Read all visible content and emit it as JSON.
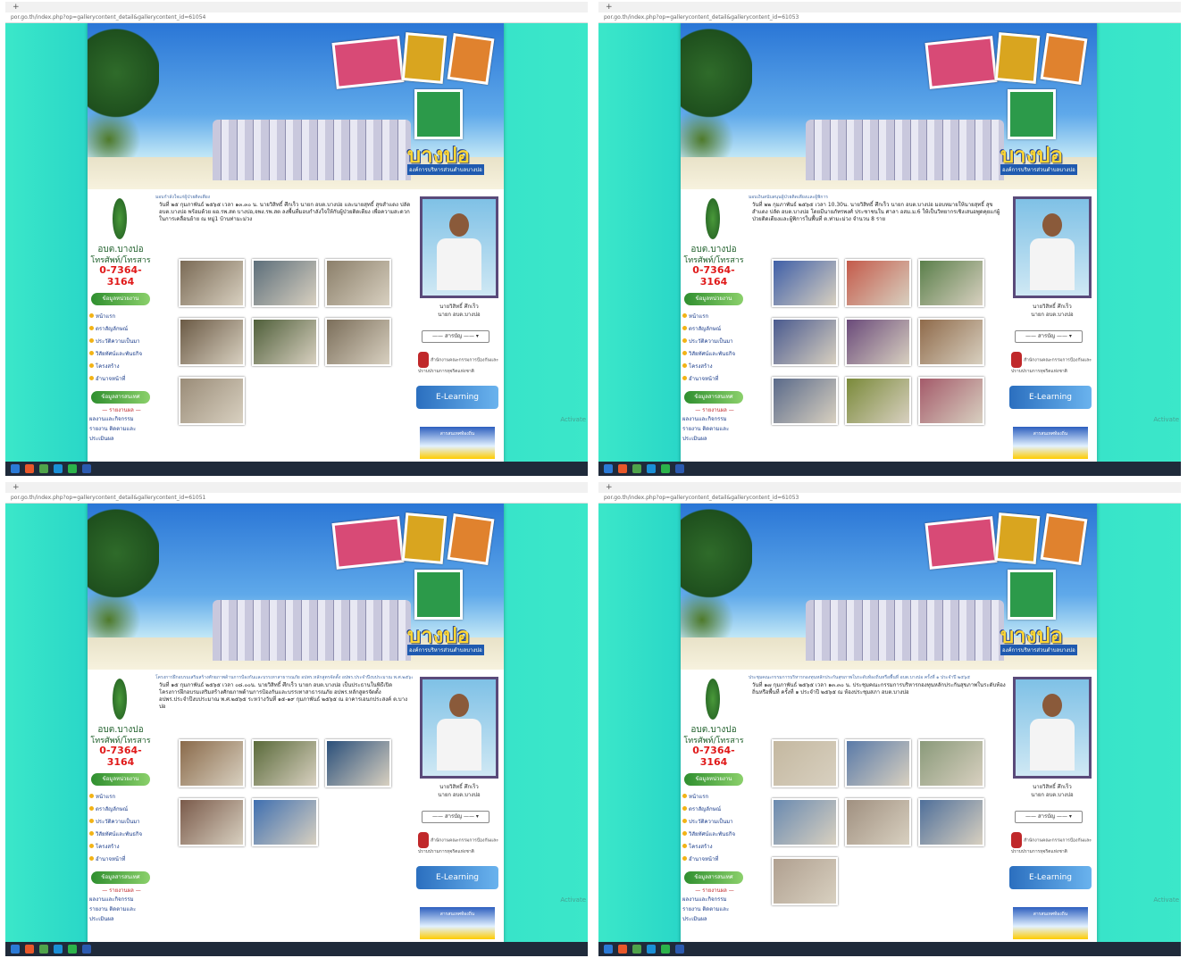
{
  "quadrants": [
    {
      "tab_label": "+",
      "url": "por.go.th/index.php?op=gallerycontent_detail&gallerycontent_id=61054",
      "breadcrumb": "มอบกำลังใจแก่ผู้ป่วยติดเตียง",
      "body_text": "วันที่ ๒๕ กุมภาพันธ์ ๒๕๖๕ เวลา ๑๓.๓๐ น. นายวิสิทธิ์ ศึกเร็ว นายก อบต.บางปอ และนายสุทธิ์ สุขสำแดง ปลัด อบต.บางปอ พร้อมด้วย ผอ.รพ.สต บางปอ,จพง.รพ.สต ลงพื้นที่มอบกำลังใจให้กับผู้ป่วยติดเตียง เพื่อความสะดวกในการเคลื่อนย้าย ณ หมู่1 บ้านท่ามะม่วง"
    },
    {
      "tab_label": "+",
      "url": "por.go.th/index.php?op=gallerycontent_detail&gallerycontent_id=61053",
      "breadcrumb": "มอบเงินสนับสนุนผู้ป่วยติดเตียงและผู้พิการ",
      "body_text": "วันที่ ๒๒ กุมภาพันธ์ ๒๕๖๕ เวลา 10.30น. นายวิสิทธิ์ ศึกเร็ว นายก อบต.บางปอ มอบหมายให้นายสุทธิ์ สุขสำแดง ปลัด อบต.บางปอ โดยมีนายภัทรพงศ์ ประชาชนใน ศาลา อสม.ม.6 ให้เป็นวิทยากรเชิงเสนอพูดคุยแก่ผู้ป่วยติดเตียงและผู้พิการในพื้นที่ ต.ท่ามะม่วง จำนวน 8 ราย"
    },
    {
      "tab_label": "+",
      "url": "por.go.th/index.php?op=gallerycontent_detail&gallerycontent_id=61051",
      "breadcrumb": "โครงการฝึกอบรมเสริมสร้างศักยภาพด้านการป้องกันและบรรเทาสาธารณภัย อปพร.หลักสูตรจัดตั้ง อปพร.ประจำปีงบประมาณ พ.ศ.๒๕๖๕",
      "body_text": "วันที่ ๑๕ กุมภาพันธ์ ๒๕๖๕ เวลา ๐๘.๐๐น. นายวิสิทธิ์ ศึกเร็ว นายก อบต.บางปอ เป็นประธานในพิธีเปิดโครงการฝึกอบรมเสริมสร้างศักยภาพด้านการป้องกันและบรรเทาสาธารณภัย อปพร.หลักสูตรจัดตั้ง อปพร.ประจำปีงบประมาณ พ.ศ.๒๕๖๕ ระหว่างวันที่ ๑๕-๑๙ กุมภาพันธ์ ๒๕๖๕ ณ อาคารเอนกประสงค์ ต.บางปอ"
    },
    {
      "tab_label": "+",
      "url": "por.go.th/index.php?op=gallerycontent_detail&gallerycontent_id=61053",
      "breadcrumb": "ประชุมคณะกรรมการบริหารกองทุนหลักประกันสุขภาพในระดับท้องถิ่นหรือพื้นที่ อบต.บางปอ ครั้งที่ ๑ ประจำปี ๒๕๖๕",
      "body_text": "วันที่ ๑๗ กุมภาพันธ์ ๒๕๖๕ เวลา ๑๓.๓๐ น. ประชุมคณะกรรมการบริหารกองทุนหลักประกันสุขภาพในระดับท้องถิ่นหรือพื้นที่ ครั้งที่ ๑ ประจำปี ๒๕๖๕ ณ ห้องประชุมสภา อบต.บางปอ"
    }
  ],
  "site": {
    "logo_text": "บางปอ",
    "logo_sub": "องค์การบริหารส่วนตำบลบางปอ",
    "org_name": "อบต.บางปอ",
    "phone_label": "โทรศัพท์/โทรสาร",
    "phone_number": "0-7364-3164",
    "section_menu": "ข้อมูลหน่วยงาน",
    "section_reports": "ข้อมูลสารสนเทศ",
    "menu": [
      "หน้าแรก",
      "ตราสัญลักษณ์",
      "ประวัติความเป็นมา",
      "วิสัยทัศน์และพันธกิจ",
      "โครงสร้าง",
      "อำนาจหน้าที่"
    ],
    "reports_head": "— รายงานผล —",
    "reports": [
      "ผลงานและกิจกรรม",
      "รายงาน ติดตามและประเมินผล"
    ],
    "mayor_name": "นายวิสิทธิ์   ศึกเร็ว",
    "mayor_title": "นายก อบต.บางปอ",
    "select_label": "——  สารบัญ  ——  ▾",
    "agency_text": "สำนักงานคณะกรรมการป้องกันและปราบปรามการทุจริตแห่งชาติ",
    "elearning": "E-Learning",
    "promo": "สารสนเทศท้องถิ่น",
    "watermark": "Activate"
  },
  "thumb_colors": [
    [
      "#7a6a55",
      "#5c6e7a",
      "#8b7f6a",
      "#6b5a45",
      "#4f5f3a",
      "#7b6e5a",
      "#9a8c78"
    ],
    [
      "#3f5fa8",
      "#c45a4a",
      "#5a7f4a",
      "#4a5a8f",
      "#6a4a7a",
      "#8f6a4a",
      "#5a6a8a",
      "#7a8a3a",
      "#a45a6a"
    ],
    [
      "#8a6a4a",
      "#5a6a3a",
      "#2a4f7a",
      "#7a5a4a",
      "#3f6fb0"
    ],
    [
      "#c4b8a0",
      "#5a7aa8",
      "#8a9a7a",
      "#6a8ab0",
      "#a09080",
      "#4f6f9a",
      "#b0a090"
    ]
  ],
  "colors": {
    "background_teal": "#3be7c9",
    "phone_red": "#e01a1a",
    "org_green": "#1e5f2a",
    "menu_blue": "#1a3c8a",
    "taskbar": "#1f2a3a"
  }
}
